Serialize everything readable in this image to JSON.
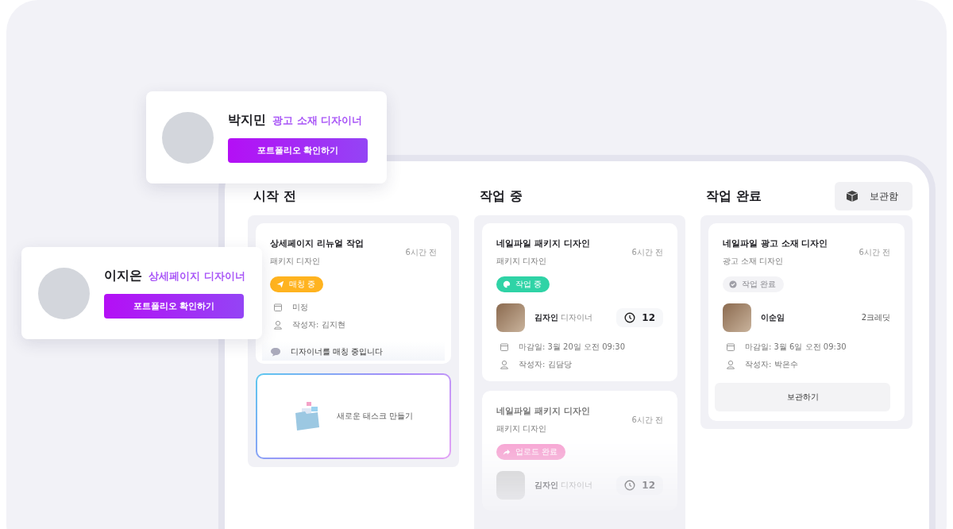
{
  "archive_button": {
    "label": "보관함"
  },
  "columns": [
    {
      "title": "시작 전",
      "cards": [
        {
          "kind": "task",
          "faded": false,
          "title": "상세페이지 리뉴얼 작업",
          "category": "패키지 디자인",
          "time": "6시간 전",
          "status": {
            "kind": "matching",
            "label": "매칭 중"
          },
          "meta": [
            {
              "kind": "date",
              "text": "미정"
            },
            {
              "kind": "author",
              "text": "작성자: 김지현"
            }
          ],
          "note": "디자이너를 매칭 중입니다"
        },
        {
          "kind": "new",
          "label": "새로운 태스크 만들기"
        }
      ]
    },
    {
      "title": "작업 중",
      "cards": [
        {
          "kind": "task",
          "faded": false,
          "title": "네일파일 패키지 디자인",
          "category": "패키지 디자인",
          "time": "6시간 전",
          "status": {
            "kind": "working",
            "label": "작업 중"
          },
          "assignee": {
            "name": "김자인",
            "role": "디자이너",
            "timer": "12"
          },
          "meta": [
            {
              "kind": "date",
              "text": "마감일: 3월 20일 오전 09:30"
            },
            {
              "kind": "author",
              "text": "작성자: 김담당"
            }
          ]
        },
        {
          "kind": "task",
          "faded": true,
          "title": "네일파일 패키지 디자인",
          "category": "패키지 디자인",
          "time": "6시간 전",
          "status": {
            "kind": "uploaded",
            "label": "업로드 완료"
          },
          "assignee": {
            "name": "김자인",
            "role": "디자이너",
            "timer": "12"
          }
        }
      ]
    },
    {
      "title": "작업 완료",
      "cards": [
        {
          "kind": "task",
          "faded": false,
          "title": "네일파일 광고 소재 디자인",
          "category": "광고 소재 디자인",
          "time": "6시간 전",
          "status": {
            "kind": "done",
            "label": "작업 완료"
          },
          "assignee": {
            "name": "이순임",
            "credits": "2크레딧"
          },
          "meta": [
            {
              "kind": "date",
              "text": "마감일: 3월 6일 오전 09:30"
            },
            {
              "kind": "author",
              "text": "작성자: 박은수"
            }
          ],
          "action": "보관하기"
        }
      ]
    }
  ],
  "profiles": [
    {
      "name": "박지민",
      "role": "광고 소재 디자이너",
      "button": "포트폴리오 확인하기"
    },
    {
      "name": "이지은",
      "role": "상세페이지 디자이너",
      "button": "포트폴리오 확인하기"
    }
  ]
}
